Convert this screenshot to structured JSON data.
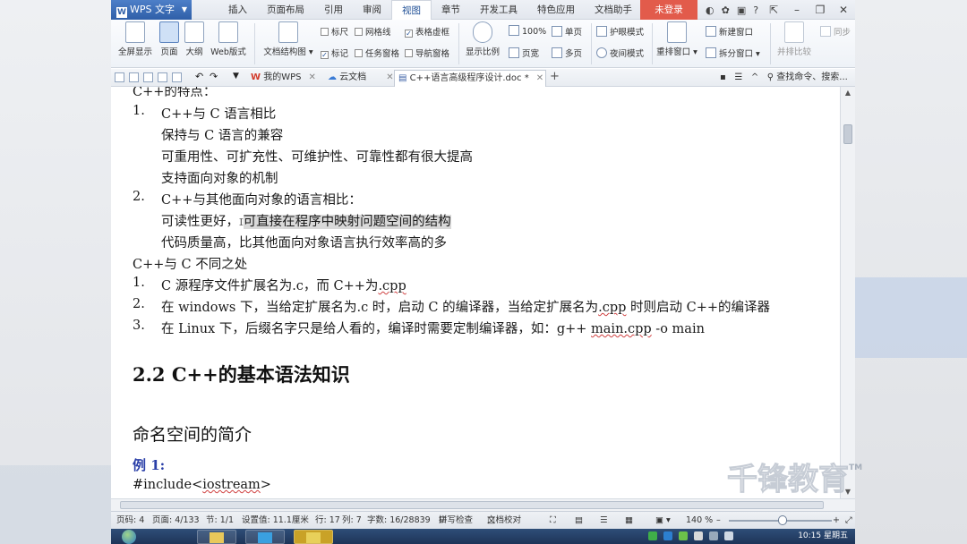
{
  "app": {
    "name": "WPS 文字",
    "login_label": "未登录"
  },
  "menu": {
    "tabs": [
      "插入",
      "页面布局",
      "引用",
      "审阅",
      "视图",
      "章节",
      "开发工具",
      "特色应用",
      "文档助手"
    ],
    "active": "视图"
  },
  "ribbon": {
    "fullscreen": "全屏显示",
    "page": "页面",
    "outline": "大纲",
    "web": "Web版式",
    "doc_structure": "文档结构图",
    "ruler": "标尺",
    "gridlines": "网格线",
    "table_gridlines": "表格虚框",
    "marks": "标记",
    "task_pane": "任务窗格",
    "nav_pane": "导航窗格",
    "zoom_ratio": "显示比例",
    "zoom_100": "100%",
    "page_width": "页宽",
    "single_page": "单页",
    "multi_page": "多页",
    "eye_mode": "护眼模式",
    "night_mode": "夜间模式",
    "rearrange": "重排窗口",
    "new_window": "新建窗口",
    "split_window": "拆分窗口",
    "side_by_side": "并排比较",
    "sync": "同步"
  },
  "toolbar": {
    "tabs": [
      {
        "label": "我的WPS"
      },
      {
        "label": "云文档"
      },
      {
        "label": "C++语言高级程序设计.doc *"
      }
    ],
    "search": "查找命令、搜索..."
  },
  "document": {
    "cut_top": "C++的特点：",
    "items1": [
      {
        "num": "1.",
        "title": "C++与 C 语言相比",
        "sub": [
          "保持与 C 语言的兼容",
          "可重用性、可扩充性、可维护性、可靠性都有很大提高",
          "支持面向对象的机制"
        ]
      },
      {
        "num": "2.",
        "title": "C++与其他面向对象的语言相比：",
        "sub_a": "可读性更好，",
        "sub_hl": "可直接在程序中映射问题空间的结构",
        "sub2": "代码质量高，比其他面向对象语言执行效率高的多"
      }
    ],
    "section_label": "C++与 C 不同之处",
    "items2": [
      {
        "num": "1.",
        "a": "C 源程序文件扩展名为.c，而 C++为",
        "b": ".cpp"
      },
      {
        "num": "2.",
        "a": "在 windows 下，当给定扩展名为.c 时，启动 C 的编译器，当给定扩展名为",
        "b": ".cpp",
        "c": " 时则启动 C++的编译器"
      },
      {
        "num": "3.",
        "a": "在 Linux 下，后缀名字只是给人看的，编译时需要定制编译器，如：g++ ",
        "b": "main.cpp",
        "c": " -o main"
      }
    ],
    "heading2": "2.2 C++的基本语法知识",
    "heading3": "命名空间的简介",
    "example": "例 1:",
    "code_a": "#include<",
    "code_b": "iostream",
    "code_c": ">"
  },
  "status": {
    "page_num": "页码: 4",
    "pages": "页面: 4/133",
    "section": "节: 1/1",
    "setting": "设置值: 11.1厘米",
    "row": "行: 17",
    "col": "列: 7",
    "words": "字数: 16/28839",
    "spell": "拼写检查",
    "proof": "文档校对",
    "zoom": "140 %"
  },
  "taskbar": {
    "time": "10:15 星期五"
  },
  "watermark": {
    "text": "千锋教育",
    "tm": "TM"
  }
}
